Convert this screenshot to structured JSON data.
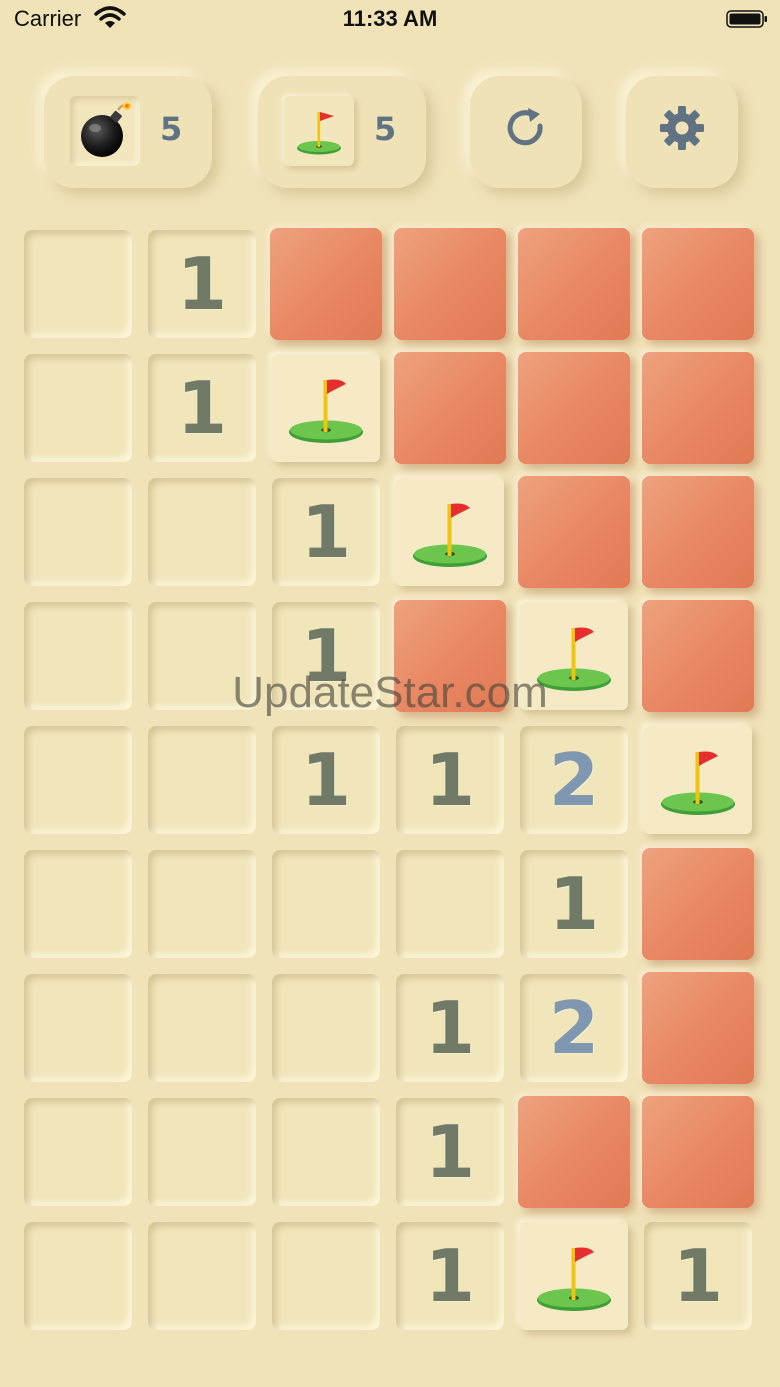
{
  "status_bar": {
    "carrier": "Carrier",
    "time": "11:33 AM",
    "wifi_icon": "wifi-icon",
    "battery_icon": "battery-icon"
  },
  "toolbar": {
    "mine_counter": {
      "icon": "bomb-icon",
      "value": "5"
    },
    "flag_counter": {
      "icon": "golf-flag-icon",
      "value": "5"
    },
    "restart_button": {
      "icon": "refresh-icon"
    },
    "settings_button": {
      "icon": "gear-icon"
    }
  },
  "board": {
    "columns": 6,
    "rows_count": 9,
    "rows": [
      [
        "E",
        "1",
        "H",
        "H",
        "H",
        "H"
      ],
      [
        "E",
        "1",
        "F",
        "H",
        "H",
        "H"
      ],
      [
        "E",
        "E",
        "1",
        "F",
        "H",
        "H"
      ],
      [
        "E",
        "E",
        "1",
        "H",
        "F",
        "H"
      ],
      [
        "E",
        "E",
        "1",
        "1",
        "2",
        "F"
      ],
      [
        "E",
        "E",
        "E",
        "E",
        "1",
        "H"
      ],
      [
        "E",
        "E",
        "E",
        "1",
        "2",
        "H"
      ],
      [
        "E",
        "E",
        "E",
        "1",
        "H",
        "H"
      ],
      [
        "E",
        "E",
        "E",
        "1",
        "F",
        "1"
      ]
    ]
  },
  "watermark": "UpdateStar.com",
  "colors": {
    "background": "#f0e3b8",
    "hidden_tile": "#e88762",
    "number_one": "#707a66",
    "number_two": "#7f97b0",
    "icon_accent": "#5f7382"
  }
}
